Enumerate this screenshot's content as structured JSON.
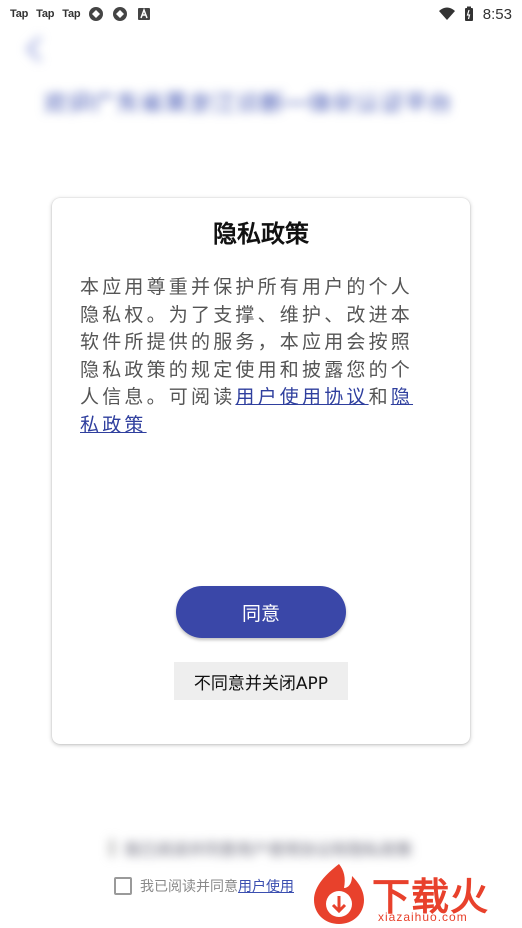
{
  "status_bar": {
    "apps": [
      "Tap",
      "Tap",
      "Tap"
    ],
    "time": "8:53"
  },
  "background": {
    "title": "欢迎广东省黑龙江诊断一体化认证平台",
    "consent_blur_text": "我已阅读并同意用户使用协议和隐私政策"
  },
  "consent": {
    "prefix": "我已阅读并同意",
    "link": "用户使用"
  },
  "dialog": {
    "title": "隐私政策",
    "body_text": "本应用尊重并保护所有用户的个人隐私权。为了支撑、维护、改进本软件所提供的服务，本应用会按照隐私政策的规定使用和披露您的个人信息。可阅读",
    "link_user_agreement": "用户使用协议",
    "conjunction": "和",
    "link_privacy": "隐私政策",
    "agree_label": "同意",
    "decline_label": "不同意并关闭APP"
  },
  "watermark": {
    "brand": "下载火",
    "domain": "xiazaihuo.com"
  },
  "colors": {
    "accent": "#3a47a8",
    "link": "#2f3f9e",
    "watermark": "#e8412c"
  }
}
